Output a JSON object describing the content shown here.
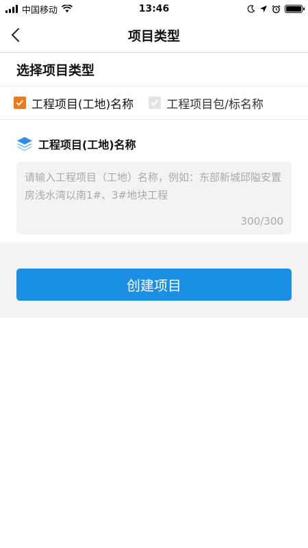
{
  "status_bar": {
    "carrier": "中国移动",
    "time": "13:46"
  },
  "nav": {
    "title": "项目类型"
  },
  "section": {
    "title": "选择项目类型"
  },
  "options": [
    {
      "label": "工程项目(工地)名称",
      "checked": true
    },
    {
      "label": "工程项目包/标名称",
      "checked": false
    }
  ],
  "field": {
    "label": "工程项目(工地)名称",
    "placeholder": "请输入工程项目（工地）名称，例如：东部新城邱隘安置房浅水湾以南1#、3#地块工程",
    "counter": "300/300"
  },
  "button": {
    "label": "创建项目"
  },
  "colors": {
    "accent": "#1a8fe3",
    "checkbox_checked": "#f07a1a"
  }
}
